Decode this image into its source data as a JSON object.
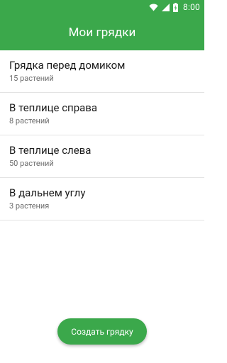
{
  "status_bar": {
    "time": "8:00",
    "icons": [
      "wifi-icon",
      "signal-icon",
      "battery-charging-icon"
    ]
  },
  "app_bar": {
    "title": "Мои грядки"
  },
  "beds": [
    {
      "name": "Грядка перед домиком",
      "count": "15 растений"
    },
    {
      "name": "В теплице справа",
      "count": "8 растений"
    },
    {
      "name": "В теплице слева",
      "count": "50 растений"
    },
    {
      "name": "В дальнем углу",
      "count": "3 растения"
    }
  ],
  "fab": {
    "label": "Создать грядку"
  },
  "colors": {
    "primary": "#3ba84b",
    "text_primary": "#1c1c1c",
    "text_secondary": "#6e6e6e",
    "divider": "#e3e3e3"
  }
}
